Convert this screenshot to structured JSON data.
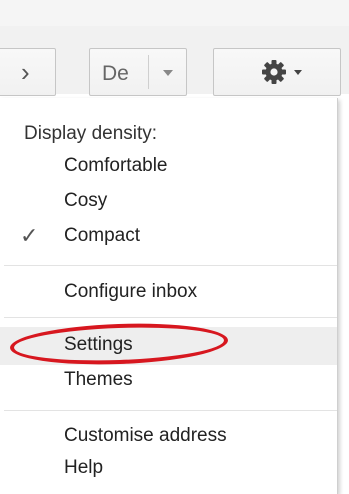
{
  "toolbar": {
    "next_icon": "chevron-right-icon",
    "density_button_label": "De",
    "density_caret_icon": "caret-down-icon",
    "settings_icon": "gear-icon",
    "settings_caret_icon": "caret-down-icon"
  },
  "menu": {
    "header": "Display density:",
    "density_options": [
      "Comfortable",
      "Cosy",
      "Compact"
    ],
    "selected_density": "Compact",
    "check_icon": "check-icon",
    "check_glyph": "✓",
    "configure_inbox": "Configure inbox",
    "settings": "Settings",
    "themes": "Themes",
    "customise_address": "Customise address",
    "help": "Help"
  },
  "annotation": {
    "color": "#d7171f",
    "target": "Settings"
  },
  "colors": {
    "toolbar_bg": "#f1f1f1",
    "menu_bg": "#ffffff",
    "hover_bg": "#eeeeee",
    "text": "#222222"
  }
}
